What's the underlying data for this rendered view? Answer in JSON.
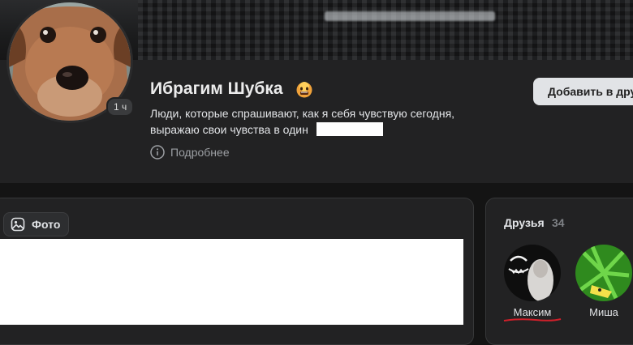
{
  "profile": {
    "name": "Ибрагим Шубка",
    "status_line1": "Люди, которые спрашивают, как я себя чувствую сегодня,",
    "status_line2": "выражаю свои чувства в один",
    "online_badge": "1 ч",
    "more_label": "Подробнее",
    "add_friend_label": "Добавить в дру"
  },
  "tabs": {
    "photo_label": "Фото"
  },
  "friends": {
    "title": "Друзья",
    "count": "34",
    "items": [
      {
        "name": "Максим"
      },
      {
        "name": "Миша"
      }
    ]
  },
  "colors": {
    "background": "#141414",
    "card": "#222223",
    "button": "#e1e3e6",
    "muted_text": "#9c9fa3",
    "underline": "#d0202a"
  },
  "icons": {
    "emoji": "scream-emoji-icon",
    "more": "info-icon",
    "photo": "image-icon"
  }
}
